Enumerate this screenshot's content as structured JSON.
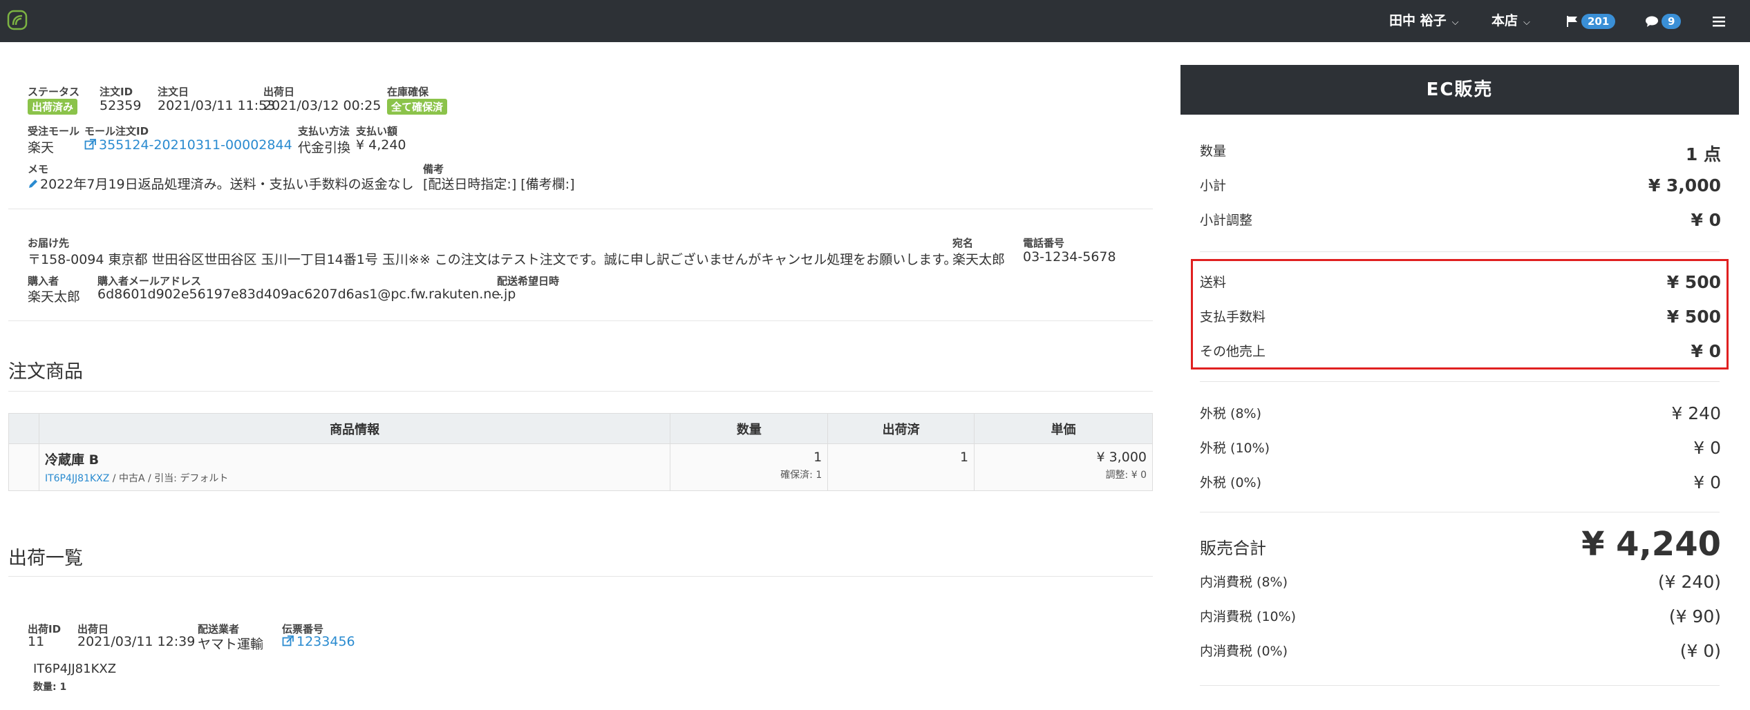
{
  "nav": {
    "user": "田中 裕子",
    "store": "本店",
    "flag_count": "201",
    "chat_count": "9"
  },
  "order": {
    "status_label": "ステータス",
    "status": "出荷済み",
    "order_id_label": "注文ID",
    "order_id": "52359",
    "order_date_label": "注文日",
    "order_date": "2021/03/11 11:53",
    "ship_date_label": "出荷日",
    "ship_date": "2021/03/12 00:25",
    "stock_label": "在庫確保",
    "stock": "全て確保済",
    "mall_label": "受注モール",
    "mall": "楽天",
    "mall_order_id_label": "モール注文ID",
    "mall_order_id": "355124-20210311-00002844",
    "payment_method_label": "支払い方法",
    "payment_method": "代金引換",
    "payment_amount_label": "支払い額",
    "payment_amount": "¥ 4,240",
    "memo_label": "メモ",
    "memo": "2022年7月19日返品処理済み。送料・支払い手数料の返金なし",
    "remarks_label": "備考",
    "remarks": "[配送日時指定:] [備考欄:]"
  },
  "delivery": {
    "address_label": "お届け先",
    "address": "〒158-0094 東京都 世田谷区世田谷区 玉川一丁目14番1号 玉川※※ この注文はテスト注文です。誠に申し訳ございませんがキャンセル処理をお願いします。",
    "recipient_label": "宛名",
    "recipient": "楽天太郎",
    "phone_label": "電話番号",
    "phone": "03-1234-5678",
    "buyer_label": "購入者",
    "buyer": "楽天太郎",
    "email_label": "購入者メールアドレス",
    "email": "6d8601d902e56197e83d409ac6207d6as1@pc.fw.rakuten.ne.jp",
    "desired_date_label": "配送希望日時",
    "desired_date": "-"
  },
  "products": {
    "title": "注文商品",
    "headers": [
      "商品情報",
      "数量",
      "出荷済",
      "単価"
    ],
    "rows": [
      {
        "name": "冷蔵庫 B",
        "sku": "IT6P4JJ81KXZ",
        "detail": " / 中古A / 引当: デフォルト",
        "qty": "1",
        "qty_sub": "確保済: 1",
        "shipped": "1",
        "price": "¥ 3,000",
        "price_sub": "調整: ¥ 0"
      }
    ]
  },
  "shipments": {
    "title": "出荷一覧",
    "ship_id_label": "出荷ID",
    "ship_id": "11",
    "ship_date_label": "出荷日",
    "ship_date": "2021/03/11 12:39",
    "carrier_label": "配送業者",
    "carrier": "ヤマト運輸",
    "tracking_label": "伝票番号",
    "tracking": "1233456",
    "item_sku": "IT6P4JJ81KXZ",
    "item_qty": "数量: 1"
  },
  "summary": {
    "title": "EC販売",
    "quantity_label": "数量",
    "quantity": "1 点",
    "subtotal_label": "小計",
    "subtotal": "¥ 3,000",
    "subtotal_adj_label": "小計調整",
    "subtotal_adj": "¥ 0",
    "shipping_label": "送料",
    "shipping": "¥ 500",
    "payment_fee_label": "支払手数料",
    "payment_fee": "¥ 500",
    "other_label": "その他売上",
    "other": "¥ 0",
    "tax8_label": "外税 (8%)",
    "tax8": "¥ 240",
    "tax10_label": "外税 (10%)",
    "tax10": "¥ 0",
    "tax0_label": "外税 (0%)",
    "tax0": "¥ 0",
    "total_label": "販売合計",
    "total": "¥ 4,240",
    "intax8_label": "内消費税 (8%)",
    "intax8": "(¥ 240)",
    "intax10_label": "内消費税 (10%)",
    "intax10": "(¥ 90)",
    "intax0_label": "内消費税 (0%)",
    "intax0": "(¥ 0)"
  },
  "colors": {
    "topbar": "#2d3136",
    "badge_green": "#8bc34a",
    "link_blue": "#2a8bd0",
    "highlight_red": "#e02020"
  }
}
